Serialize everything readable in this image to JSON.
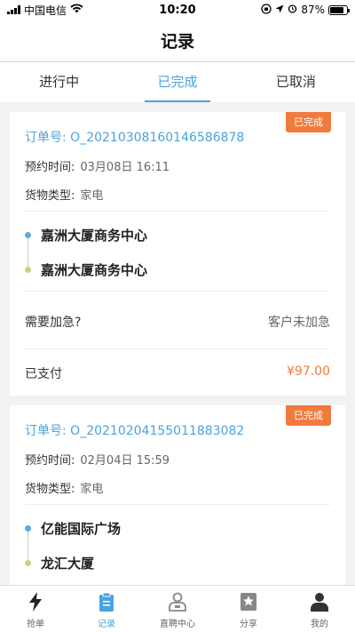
{
  "status_bar": {
    "carrier": "中国电信",
    "time": "10:20",
    "battery": "87%"
  },
  "header": {
    "title": "记录"
  },
  "tabs": [
    {
      "label": "进行中",
      "active": false
    },
    {
      "label": "已完成",
      "active": true
    },
    {
      "label": "已取消",
      "active": false
    }
  ],
  "orders": [
    {
      "status": "已完成",
      "order_label": "订单号:",
      "order_no": "O_20210308160146586878",
      "reserve_label": "预约时间:",
      "reserve_time": "03月08日 16:11",
      "goods_label": "货物类型:",
      "goods_type": "家电",
      "from": "嘉洲大厦商务中心",
      "to": "嘉洲大厦商务中心",
      "urgent_label": "需要加急?",
      "urgent_value": "客户未加急",
      "paid_label": "已支付",
      "price": "¥97.00"
    },
    {
      "status": "已完成",
      "order_label": "订单号:",
      "order_no": "O_20210204155011883082",
      "reserve_label": "预约时间:",
      "reserve_time": "02月04日 15:59",
      "goods_label": "货物类型:",
      "goods_type": "家电",
      "from": "亿能国际广场",
      "to": "龙汇大厦"
    }
  ],
  "bottom_nav": [
    {
      "label": "抢单",
      "icon": "lightning-icon",
      "active": false
    },
    {
      "label": "记录",
      "icon": "clipboard-icon",
      "active": true
    },
    {
      "label": "直聘中心",
      "icon": "recruit-icon",
      "active": false
    },
    {
      "label": "分享",
      "icon": "share-star-icon",
      "active": false
    },
    {
      "label": "我的",
      "icon": "person-icon",
      "active": false
    }
  ],
  "colors": {
    "accent": "#4aa3df",
    "badge": "#f07b3f",
    "price": "#f07b3f"
  }
}
